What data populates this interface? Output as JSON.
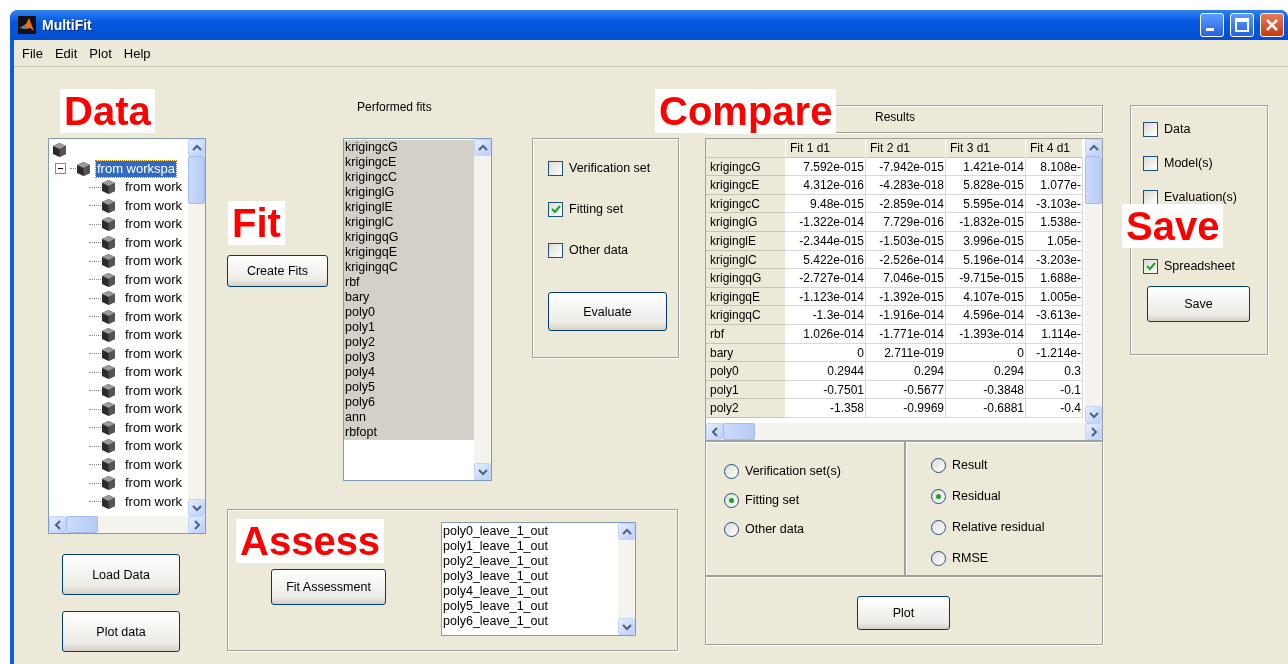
{
  "window": {
    "title": "MultiFit"
  },
  "menu": [
    "File",
    "Edit",
    "Plot",
    "Help"
  ],
  "annotations": {
    "data": "Data",
    "fit": "Fit",
    "compare": "Compare",
    "assess": "Assess",
    "save": "Save"
  },
  "data_tree": {
    "children": [
      {
        "label": "from workspa",
        "selected": true,
        "expanded": true,
        "children": [
          {
            "label": "from work",
            "selected": false
          },
          {
            "label": "from work",
            "selected": false
          },
          {
            "label": "from work",
            "selected": false
          },
          {
            "label": "from work",
            "selected": false
          },
          {
            "label": "from work",
            "selected": false
          },
          {
            "label": "from work",
            "selected": false
          },
          {
            "label": "from work",
            "selected": false
          },
          {
            "label": "from work",
            "selected": false
          },
          {
            "label": "from work",
            "selected": false
          },
          {
            "label": "from work",
            "selected": false
          },
          {
            "label": "from work",
            "selected": false
          },
          {
            "label": "from work",
            "selected": false
          },
          {
            "label": "from work",
            "selected": false
          },
          {
            "label": "from work",
            "selected": false
          },
          {
            "label": "from work",
            "selected": false
          },
          {
            "label": "from work",
            "selected": false
          },
          {
            "label": "from work",
            "selected": false
          },
          {
            "label": "from work",
            "selected": false
          }
        ]
      }
    ]
  },
  "data_buttons": [
    "Load Data",
    "Plot data"
  ],
  "create_fits_button": "Create Fits",
  "performed_fits": {
    "label": "Performed fits",
    "items": [
      {
        "label": "krigingcG",
        "selected": true
      },
      {
        "label": "krigingcE",
        "selected": true
      },
      {
        "label": "krigingcC",
        "selected": true
      },
      {
        "label": "kriginglG",
        "selected": true
      },
      {
        "label": "kriginglE",
        "selected": true
      },
      {
        "label": "kriginglC",
        "selected": true
      },
      {
        "label": "krigingqG",
        "selected": true
      },
      {
        "label": "krigingqE",
        "selected": true
      },
      {
        "label": "krigingqC",
        "selected": true
      },
      {
        "label": "rbf",
        "selected": true
      },
      {
        "label": "bary",
        "selected": true
      },
      {
        "label": "poly0",
        "selected": true
      },
      {
        "label": "poly1",
        "selected": true
      },
      {
        "label": "poly2",
        "selected": true
      },
      {
        "label": "poly3",
        "selected": true
      },
      {
        "label": "poly4",
        "selected": true
      },
      {
        "label": "poly5",
        "selected": true
      },
      {
        "label": "poly6",
        "selected": true
      },
      {
        "label": "ann",
        "selected": true
      },
      {
        "label": "rbfopt",
        "selected": true
      }
    ]
  },
  "evaluate": {
    "options": [
      {
        "label": "Verification set",
        "checked": false
      },
      {
        "label": "Fitting set",
        "checked": true
      },
      {
        "label": "Other data",
        "checked": false
      }
    ],
    "button": "Evaluate"
  },
  "assess": {
    "button": "Fit Assessment",
    "items": [
      "poly0_leave_1_out",
      "poly1_leave_1_out",
      "poly2_leave_1_out",
      "poly3_leave_1_out",
      "poly4_leave_1_out",
      "poly5_leave_1_out",
      "poly6_leave_1_out"
    ]
  },
  "results": {
    "title": "Results",
    "columns": [
      "Fit 1 d1",
      "Fit 2 d1",
      "Fit 3 d1",
      "Fit 4 d1"
    ],
    "rows": [
      {
        "label": "krigingcG",
        "cells": [
          "7.592e-015",
          "-7.942e-015",
          "1.421e-014",
          "8.108e-"
        ]
      },
      {
        "label": "krigingcE",
        "cells": [
          "4.312e-016",
          "-4.283e-018",
          "5.828e-015",
          "1.077e-"
        ]
      },
      {
        "label": "krigingcC",
        "cells": [
          "9.48e-015",
          "-2.859e-014",
          "5.595e-014",
          "-3.103e-"
        ]
      },
      {
        "label": "kriginglG",
        "cells": [
          "-1.322e-014",
          "7.729e-016",
          "-1.832e-015",
          "1.538e-"
        ]
      },
      {
        "label": "kriginglE",
        "cells": [
          "-2.344e-015",
          "-1.503e-015",
          "3.996e-015",
          "1.05e-"
        ]
      },
      {
        "label": "kriginglC",
        "cells": [
          "5.422e-016",
          "-2.526e-014",
          "5.196e-014",
          "-3.203e-"
        ]
      },
      {
        "label": "krigingqG",
        "cells": [
          "-2.727e-014",
          "7.046e-015",
          "-9.715e-015",
          "1.688e-"
        ]
      },
      {
        "label": "krigingqE",
        "cells": [
          "-1.123e-014",
          "-1.392e-015",
          "4.107e-015",
          "1.005e-"
        ]
      },
      {
        "label": "krigingqC",
        "cells": [
          "-1.3e-014",
          "-1.916e-014",
          "4.596e-014",
          "-3.613e-"
        ]
      },
      {
        "label": "rbf",
        "cells": [
          "1.026e-014",
          "-1.771e-014",
          "-1.393e-014",
          "1.114e-"
        ]
      },
      {
        "label": "bary",
        "cells": [
          "0",
          "2.711e-019",
          "0",
          "-1.214e-"
        ]
      },
      {
        "label": "poly0",
        "cells": [
          "0.2944",
          "0.294",
          "0.294",
          "0.3"
        ]
      },
      {
        "label": "poly1",
        "cells": [
          "-0.7501",
          "-0.5677",
          "-0.3848",
          "-0.1"
        ]
      },
      {
        "label": "poly2",
        "cells": [
          "-1.358",
          "-0.9969",
          "-0.6881",
          "-0.4"
        ]
      }
    ]
  },
  "compare_data": [
    {
      "label": "Verification set(s)",
      "selected": false
    },
    {
      "label": "Fitting set",
      "selected": true
    },
    {
      "label": "Other data",
      "selected": false
    }
  ],
  "compare_type": [
    {
      "label": "Result",
      "selected": false
    },
    {
      "label": "Residual",
      "selected": true
    },
    {
      "label": "Relative residual",
      "selected": false
    },
    {
      "label": "RMSE",
      "selected": false
    }
  ],
  "plot_button": "Plot",
  "save": {
    "options": [
      {
        "label": "Data",
        "checked": false
      },
      {
        "label": "Model(s)",
        "checked": false
      },
      {
        "label": "Evaluation(s)",
        "checked": false
      },
      {
        "label": "Spreadsheet",
        "checked": true
      }
    ],
    "button": "Save"
  }
}
